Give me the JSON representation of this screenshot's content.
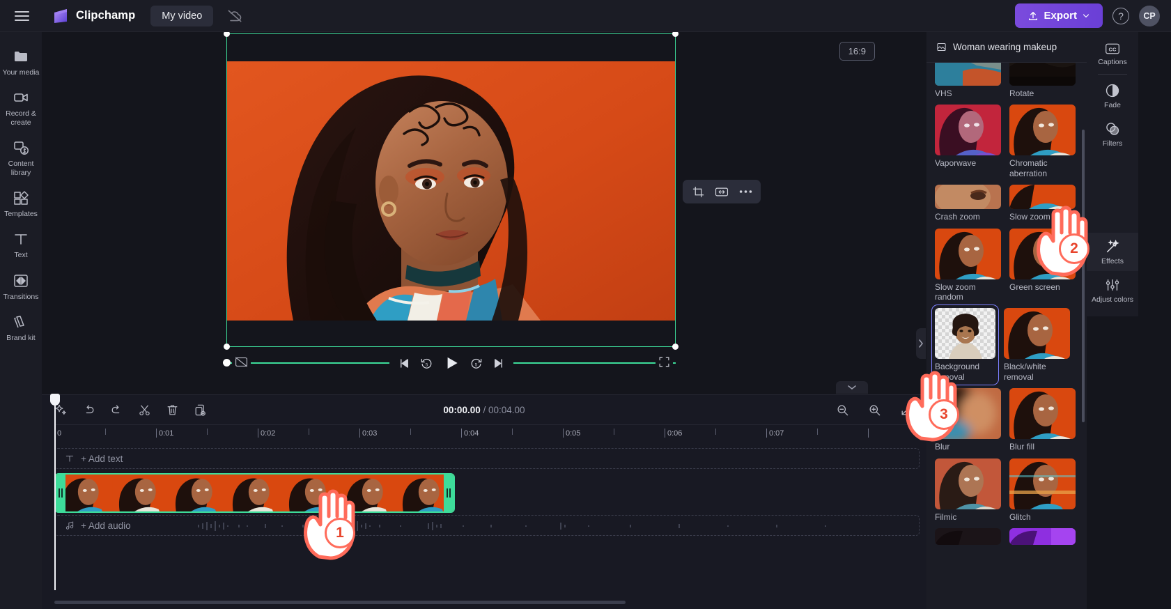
{
  "app": {
    "brand": "Clipchamp",
    "project_name": "My video",
    "menu_icon": "hamburger-icon",
    "cloud_icon": "cloud-off-icon",
    "export_label": "Export",
    "help_icon": "help-icon",
    "avatar_initials": "CP"
  },
  "left_rail": {
    "items": [
      {
        "label": "Your media",
        "icon": "folder-icon"
      },
      {
        "label": "Record & create",
        "icon": "camera-icon"
      },
      {
        "label": "Content library",
        "icon": "content-library-icon"
      },
      {
        "label": "Templates",
        "icon": "templates-icon"
      },
      {
        "label": "Text",
        "icon": "text-icon"
      },
      {
        "label": "Transitions",
        "icon": "transitions-icon"
      },
      {
        "label": "Brand kit",
        "icon": "brand-kit-icon"
      }
    ],
    "collapse_icon": "chevron-left-icon"
  },
  "stage": {
    "aspect_ratio": "16:9",
    "float_tools": [
      {
        "name": "crop-button",
        "icon": "crop-icon"
      },
      {
        "name": "fit-button",
        "icon": "fit-icon"
      },
      {
        "name": "more-button",
        "icon": "ellipsis-icon"
      }
    ],
    "player_controls": [
      {
        "name": "skip-back-button",
        "icon": "skip-previous-icon"
      },
      {
        "name": "rewind-5-button",
        "icon": "rewind-5-icon",
        "label": "5"
      },
      {
        "name": "play-button",
        "icon": "play-icon"
      },
      {
        "name": "forward-5-button",
        "icon": "forward-5-icon",
        "label": "5"
      },
      {
        "name": "skip-forward-button",
        "icon": "skip-next-icon"
      }
    ],
    "caption_toggle_icon": "captions-off-icon",
    "fullscreen_icon": "fullscreen-icon",
    "collapse_icon": "chevron-right-icon"
  },
  "timeline": {
    "tools": [
      {
        "name": "magic-tools-button",
        "icon": "sparkle-icon"
      },
      {
        "name": "undo-button",
        "icon": "undo-icon"
      },
      {
        "name": "redo-button",
        "icon": "redo-icon"
      },
      {
        "name": "split-button",
        "icon": "scissors-icon"
      },
      {
        "name": "delete-button",
        "icon": "trash-icon"
      },
      {
        "name": "duplicate-button",
        "icon": "duplicate-icon"
      }
    ],
    "current_time": "00:00.00",
    "separator": "/",
    "total_time": "00:04.00",
    "zoom_out_icon": "zoom-out-icon",
    "zoom_in_icon": "zoom-in-icon",
    "fit-timeline_icon": "fit-timeline-icon",
    "collapse_icon": "chevron-down-icon",
    "ruler_labels": [
      "0",
      "0:01",
      "0:02",
      "0:03",
      "0:04",
      "0:05",
      "0:06",
      "0:07"
    ],
    "text_track": {
      "label": "+ Add text",
      "icon": "text-track-icon"
    },
    "audio_track": {
      "label": "+ Add audio",
      "icon": "music-note-icon"
    }
  },
  "effects_panel": {
    "header_title": "Woman wearing makeup",
    "header_icon": "image-icon",
    "items": [
      {
        "label": "VHS",
        "selected": false,
        "partial": true
      },
      {
        "label": "Rotate",
        "selected": false,
        "partial": true
      },
      {
        "label": "Vaporwave",
        "selected": false
      },
      {
        "label": "Chromatic aberration",
        "selected": false
      },
      {
        "label": "Crash zoom",
        "selected": false,
        "partial": true
      },
      {
        "label": "Slow zoom",
        "selected": false,
        "partial": true
      },
      {
        "label": "Slow zoom random",
        "selected": false
      },
      {
        "label": "Green screen",
        "selected": false
      },
      {
        "label": "Background removal",
        "selected": true
      },
      {
        "label": "Black/white removal",
        "selected": false
      },
      {
        "label": "Blur",
        "selected": false
      },
      {
        "label": "Blur fill",
        "selected": false
      },
      {
        "label": "Filmic",
        "selected": false
      },
      {
        "label": "Glitch",
        "selected": false
      },
      {
        "label": "",
        "selected": false,
        "partial": true
      },
      {
        "label": "",
        "selected": false,
        "partial": true
      }
    ]
  },
  "right_rail": {
    "items": [
      {
        "label": "Captions",
        "icon": "cc-icon",
        "active": false
      },
      {
        "label": "Fade",
        "icon": "fade-icon",
        "active": false
      },
      {
        "label": "Filters",
        "icon": "filters-icon",
        "active": false
      },
      {
        "label": "Effects",
        "icon": "magic-wand-icon",
        "active": true
      },
      {
        "label": "Adjust colors",
        "icon": "adjust-colors-icon",
        "active": false
      }
    ]
  },
  "callouts": [
    {
      "number": "1",
      "target": "timeline-clip"
    },
    {
      "number": "2",
      "target": "effects-tab"
    },
    {
      "number": "3",
      "target": "background-removal-effect"
    }
  ],
  "colors": {
    "accent_green": "#3ddc9a",
    "export_purple": "#7b4bdd",
    "callout_red": "#ff6b5a",
    "panel_bg": "#1b1c25",
    "app_bg": "#14151c",
    "selection_blue": "#7d80ff"
  }
}
